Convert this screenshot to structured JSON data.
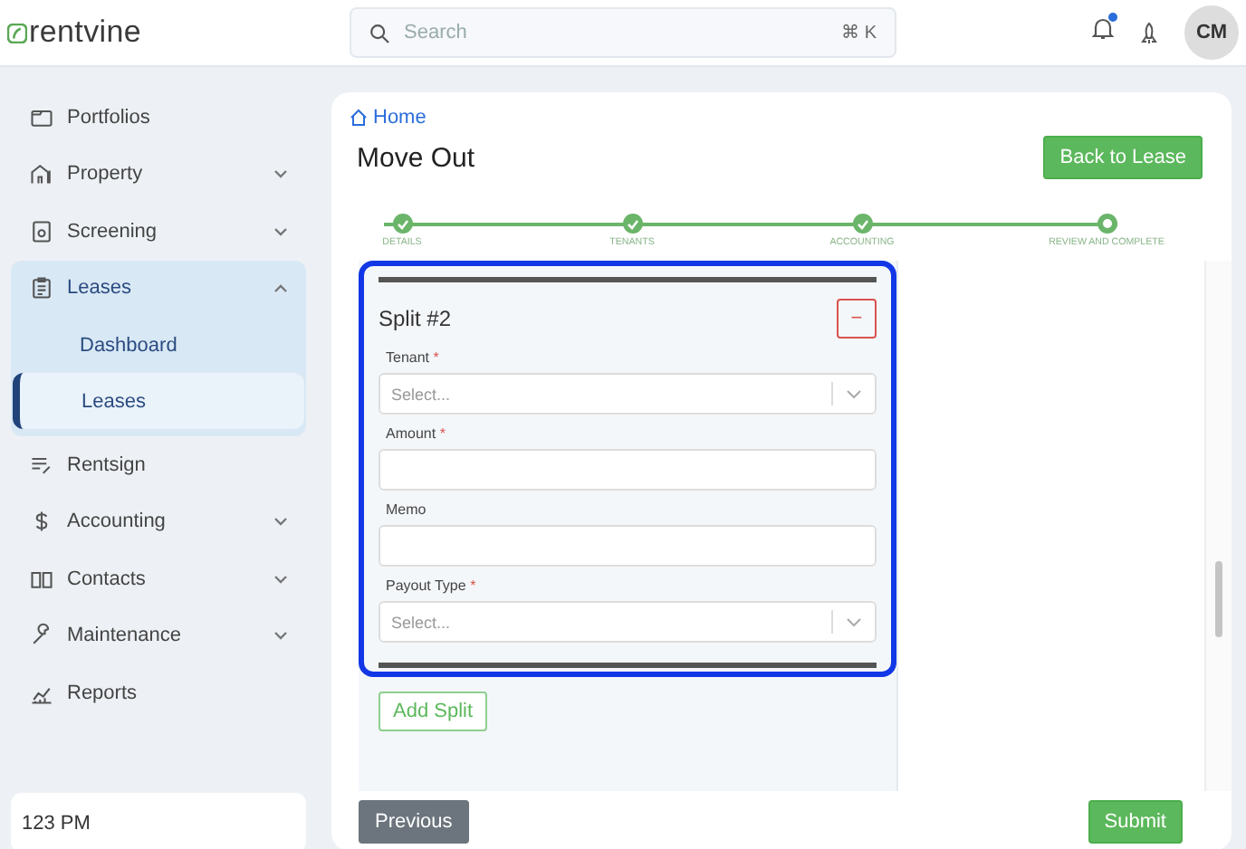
{
  "header": {
    "logo": "rentvine",
    "search": {
      "placeholder": "Search",
      "shortcut": "⌘ K"
    },
    "notifications_unread": true,
    "avatar": "CM"
  },
  "sidebar": {
    "items": [
      {
        "label": "Portfolios",
        "selected": false
      },
      {
        "label": "Property",
        "expanded": false,
        "selected": false
      },
      {
        "label": "Screening",
        "expanded": false,
        "selected": false
      },
      {
        "label": "Leases",
        "expanded": true,
        "selected": true,
        "children": [
          {
            "label": "Dashboard",
            "selected": false
          },
          {
            "label": "Leases",
            "selected": true
          }
        ]
      },
      {
        "label": "Rentsign",
        "selected": false
      },
      {
        "label": "Accounting",
        "expanded": false,
        "selected": false
      },
      {
        "label": "Contacts",
        "expanded": false,
        "selected": false
      },
      {
        "label": "Maintenance",
        "expanded": false,
        "selected": false
      },
      {
        "label": "Reports",
        "selected": false
      }
    ],
    "footer": "123 PM"
  },
  "main": {
    "breadcrumb": "Home",
    "title": "Move Out",
    "back_button": "Back to Lease",
    "steps": [
      {
        "label": "DETAILS",
        "completed": true
      },
      {
        "label": "TENANTS",
        "completed": true
      },
      {
        "label": "ACCOUNTING",
        "completed": true
      },
      {
        "label": "REVIEW AND COMPLETE",
        "completed": false
      }
    ],
    "split": {
      "title": "Split #2",
      "remove_button": "−",
      "highlighted": true,
      "fields": [
        {
          "label": "Tenant",
          "required_mark": "*",
          "kind": "select",
          "placeholder": "Select..."
        },
        {
          "label": "Amount",
          "required_mark": "*",
          "kind": "text"
        },
        {
          "label": "Memo",
          "kind": "text"
        },
        {
          "label": "Payout Type",
          "required_mark": "*",
          "kind": "select",
          "placeholder": "Select..."
        }
      ]
    },
    "add_button": "Add Split",
    "previous_button": "Previous",
    "submit_button": "Submit"
  }
}
